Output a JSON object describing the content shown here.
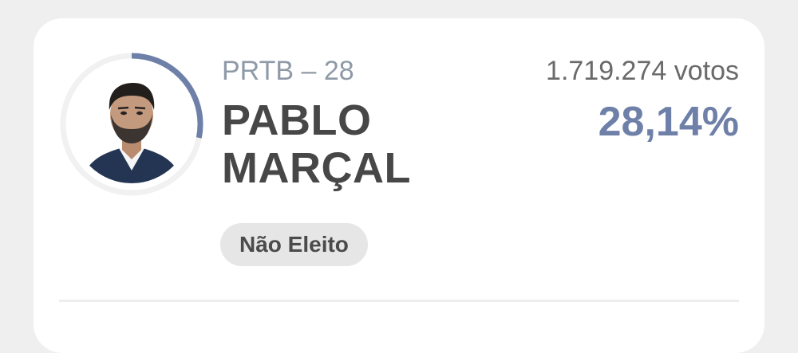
{
  "candidate": {
    "party_label": "PRTB – 28",
    "name": "PABLO\nMARÇAL",
    "votes_label": "1.719.274 votos",
    "percent_label": "28,14%",
    "status": "Não Eleito",
    "vote_share_ring_fraction": 0.2814,
    "photo_icon": "candidate-photo"
  },
  "colors": {
    "accent": "#6f80a8",
    "ring_track": "#f1f1f1",
    "badge_bg": "#e6e6e6",
    "name_text": "#474747",
    "party_text": "#8f9aa8"
  }
}
